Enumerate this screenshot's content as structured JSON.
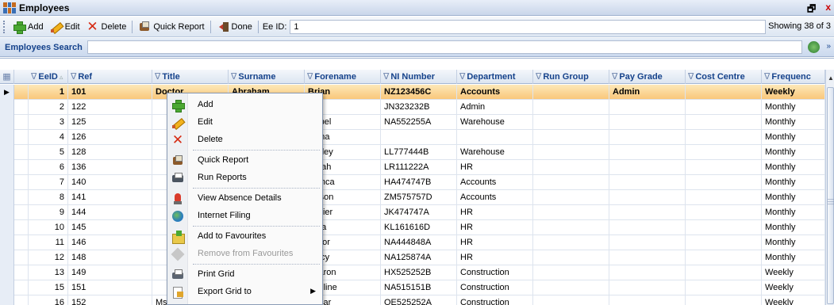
{
  "window": {
    "title": "Employees",
    "restore_glyph": "🗗",
    "close_glyph": "x"
  },
  "toolbar": {
    "add": "Add",
    "edit": "Edit",
    "delete": "Delete",
    "quick_report": "Quick Report",
    "done": "Done",
    "eeid_label": "Ee ID:",
    "eeid_value": "1",
    "showing": "Showing 38 of 3"
  },
  "search": {
    "label": "Employees Search",
    "value": ""
  },
  "grid": {
    "columns": [
      "EeID",
      "Ref",
      "Title",
      "Surname",
      "Forename",
      "NI Number",
      "Department",
      "Run Group",
      "Pay Grade",
      "Cost Centre",
      "Frequenc"
    ],
    "rows": [
      [
        "1",
        "101",
        "Doctor",
        "Abraham",
        "Brian",
        "NZ123456C",
        "Accounts",
        "",
        "Admin",
        "",
        "Weekly"
      ],
      [
        "2",
        "122",
        "",
        "",
        "Ann",
        "JN323232B",
        "Admin",
        "",
        "",
        "",
        "Monthly"
      ],
      [
        "3",
        "125",
        "",
        "",
        "Isabel",
        "NA552255A",
        "Warehouse",
        "",
        "",
        "",
        "Monthly"
      ],
      [
        "4",
        "126",
        "",
        "",
        "Fiona",
        "",
        "",
        "",
        "",
        "",
        "Monthly"
      ],
      [
        "5",
        "128",
        "",
        "",
        "Lesley",
        "LL777444B",
        "Warehouse",
        "",
        "",
        "",
        "Monthly"
      ],
      [
        "6",
        "136",
        "",
        "",
        "Sarah",
        "LR111222A",
        "HR",
        "",
        "",
        "",
        "Monthly"
      ],
      [
        "7",
        "140",
        "",
        "",
        "Bianca",
        "HA474747B",
        "Accounts",
        "",
        "",
        "",
        "Monthly"
      ],
      [
        "8",
        "141",
        "",
        "",
        "Allison",
        "ZM575757D",
        "Accounts",
        "",
        "",
        "",
        "Monthly"
      ],
      [
        "9",
        "144",
        "",
        "",
        "Xavier",
        "JK474747A",
        "HR",
        "",
        "",
        "",
        "Monthly"
      ],
      [
        "10",
        "145",
        "",
        "",
        "Olga",
        "KL161616D",
        "HR",
        "",
        "",
        "",
        "Monthly"
      ],
      [
        "11",
        "146",
        "",
        "",
        "Victor",
        "NA444848A",
        "HR",
        "",
        "",
        "",
        "Monthly"
      ],
      [
        "12",
        "148",
        "",
        "",
        "Tracy",
        "NA125874A",
        "HR",
        "",
        "",
        "",
        "Monthly"
      ],
      [
        "13",
        "149",
        "",
        "",
        "Sharon",
        "HX525252B",
        "Construction",
        "",
        "",
        "",
        "Weekly"
      ],
      [
        "15",
        "151",
        "",
        "",
        "Pauline",
        "NA515151B",
        "Construction",
        "",
        "",
        "",
        "Weekly"
      ],
      [
        "16",
        "152",
        "Ms",
        "Edwards",
        "Oscar",
        "OE525252A",
        "Construction",
        "",
        "",
        "",
        "Weekly"
      ]
    ]
  },
  "context_menu": {
    "items": [
      {
        "label": "Add",
        "icon": "add-icon"
      },
      {
        "label": "Edit",
        "icon": "edit-icon"
      },
      {
        "label": "Delete",
        "icon": "delete-icon"
      },
      {
        "label": "Quick Report",
        "icon": "quick-report-icon"
      },
      {
        "label": "Run Reports",
        "icon": "run-reports-icon"
      },
      {
        "label": "View Absence Details",
        "icon": "absence-icon"
      },
      {
        "label": "Internet Filing",
        "icon": "globe-icon"
      },
      {
        "label": "Add to Favourites",
        "icon": "add-favourite-icon"
      },
      {
        "label": "Remove from Favourites",
        "icon": "remove-favourite-icon",
        "disabled": true
      },
      {
        "label": "Print Grid",
        "icon": "print-icon"
      },
      {
        "label": "Export Grid to",
        "icon": "export-icon",
        "submenu": true
      }
    ]
  }
}
